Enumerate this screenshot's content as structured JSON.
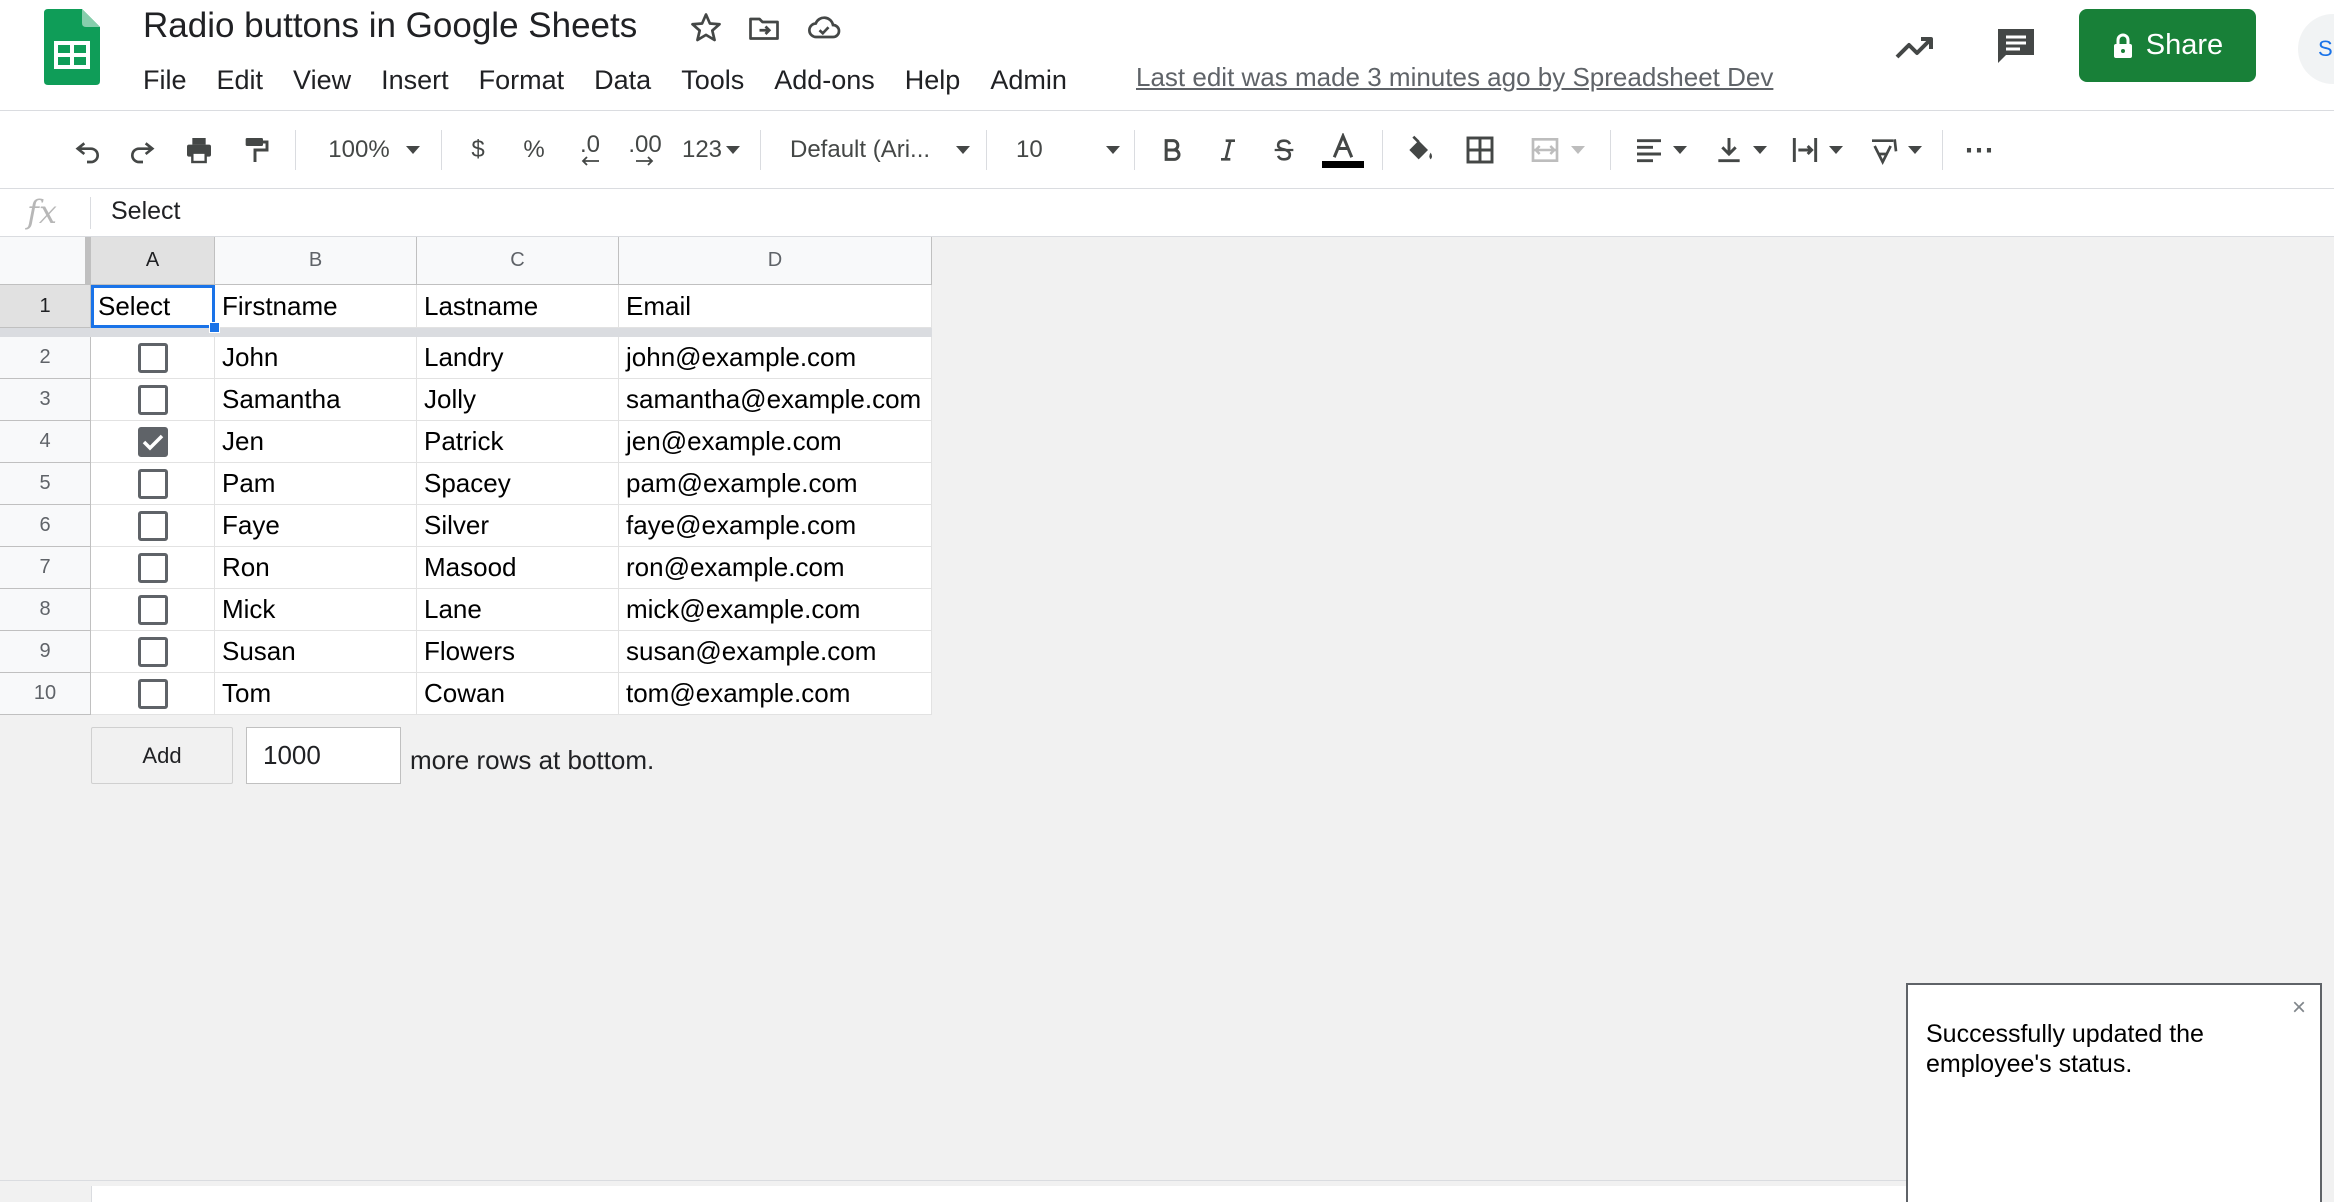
{
  "app": {
    "title": "Radio buttons in Google Sheets",
    "last_edit": "Last edit was made 3 minutes ago by Spreadsheet Dev",
    "share_label": "Share",
    "avatar_text": "S",
    "colors": {
      "accent": "#1a73e8",
      "share": "#188038",
      "sheets_green": "#0f9d58"
    }
  },
  "menu": [
    "File",
    "Edit",
    "View",
    "Insert",
    "Format",
    "Data",
    "Tools",
    "Add-ons",
    "Help",
    "Admin"
  ],
  "toolbar": {
    "zoom": "100%",
    "currency": "$",
    "percent": "%",
    "decrease_decimal": ".0",
    "increase_decimal": ".00",
    "more_formats": "123",
    "font": "Default (Ari...",
    "font_size": "10",
    "more": "⋯"
  },
  "formula_bar": {
    "fx": "fx",
    "value": "Select"
  },
  "sheet": {
    "columns": [
      "A",
      "B",
      "C",
      "D"
    ],
    "row_numbers": [
      "1",
      "2",
      "3",
      "4",
      "5",
      "6",
      "7",
      "8",
      "9",
      "10"
    ],
    "header": [
      "Select",
      "Firstname",
      "Lastname",
      "Email"
    ],
    "rows": [
      {
        "checked": false,
        "first": "John",
        "last": "Landry",
        "email": "john@example.com"
      },
      {
        "checked": false,
        "first": "Samantha",
        "last": "Jolly",
        "email": "samantha@example.com"
      },
      {
        "checked": true,
        "first": "Jen",
        "last": "Patrick",
        "email": "jen@example.com"
      },
      {
        "checked": false,
        "first": "Pam",
        "last": "Spacey",
        "email": "pam@example.com"
      },
      {
        "checked": false,
        "first": "Faye",
        "last": "Silver",
        "email": "faye@example.com"
      },
      {
        "checked": false,
        "first": "Ron",
        "last": "Masood",
        "email": "ron@example.com"
      },
      {
        "checked": false,
        "first": "Mick",
        "last": "Lane",
        "email": "mick@example.com"
      },
      {
        "checked": false,
        "first": "Susan",
        "last": "Flowers",
        "email": "susan@example.com"
      },
      {
        "checked": false,
        "first": "Tom",
        "last": "Cowan",
        "email": "tom@example.com"
      }
    ]
  },
  "add_rows": {
    "button": "Add",
    "count": "1000",
    "suffix": "more rows at bottom."
  },
  "toast": {
    "message": "Successfully updated the employee's status.",
    "close": "×"
  }
}
